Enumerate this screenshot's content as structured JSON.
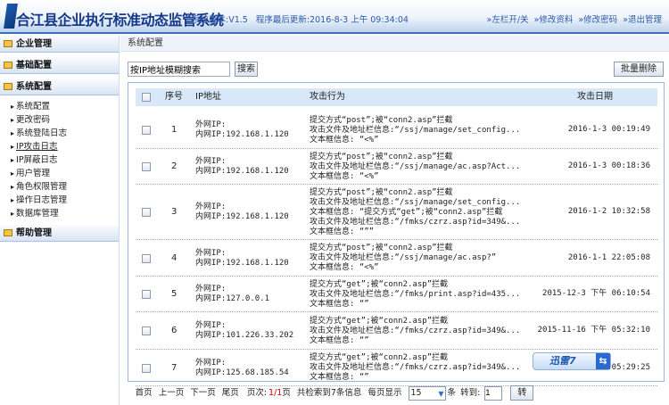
{
  "header": {
    "title": "合江县企业执行标准动态监管系统",
    "version": "系统版本:V1.5",
    "updated": "程序最后更新:2016-8-3 上午  09:34:04",
    "links": [
      "»左栏开/关",
      "»修改资料",
      "»修改密码",
      "»退出管理"
    ]
  },
  "sidebar": {
    "sections": [
      "企业管理",
      "基础配置",
      "系统配置",
      "帮助管理"
    ],
    "items": [
      "系统配置",
      "更改密码",
      "系统登陆日志",
      "IP攻击日志",
      "IP屏蔽日志",
      "用户管理",
      "角色权限管理",
      "操作日志管理",
      "数据库管理"
    ]
  },
  "breadcrumb": "系统配置",
  "search": {
    "value": "按IP地址模糊搜索",
    "button": "搜索",
    "batch_delete": "批量删除"
  },
  "table": {
    "headers": [
      "序号",
      "IP地址",
      "攻击行为",
      "攻击日期"
    ],
    "rows": [
      {
        "no": "1",
        "ip1": "外网IP:",
        "ip2": "内网IP:192.168.1.120",
        "act": [
          "提交方式“post”;被“conn2.asp”拦截",
          "攻击文件及地址栏信息:“/ssj/manage/set_config...",
          "文本框信息: “<%”"
        ],
        "date": "2016-1-3 00:19:49"
      },
      {
        "no": "2",
        "ip1": "外网IP:",
        "ip2": "内网IP:192.168.1.120",
        "act": [
          "提交方式“post”;被“conn2.asp”拦截",
          "攻击文件及地址栏信息:“/ssj/manage/ac.asp?Act...",
          "文本框信息: “<%”"
        ],
        "date": "2016-1-3 00:18:36"
      },
      {
        "no": "3",
        "ip1": "外网IP:",
        "ip2": "内网IP:192.168.1.120",
        "act": [
          "提交方式“post”;被“conn2.asp”拦截",
          "攻击文件及地址栏信息:“/ssj/manage/set_config...",
          "文本框信息: “提交方式“get”;被“conn2.asp”拦截",
          "攻击文件及地址栏信息:“/fmks/czrz.asp?id=349&...",
          "文本框信息: “”” "
        ],
        "date": "2016-1-2 10:32:58"
      },
      {
        "no": "4",
        "ip1": "外网IP:",
        "ip2": "内网IP:192.168.1.120",
        "act": [
          "提交方式“post”;被“conn2.asp”拦截",
          "攻击文件及地址栏信息:“/ssj/manage/ac.asp?”",
          "文本框信息: “<%”"
        ],
        "date": "2016-1-1 22:05:08"
      },
      {
        "no": "5",
        "ip1": "外网IP:",
        "ip2": "内网IP:127.0.0.1",
        "act": [
          "提交方式“get”;被“conn2.asp”拦截",
          "攻击文件及地址栏信息:“/fmks/print.asp?id=435...",
          "文本框信息: “”"
        ],
        "date": "2015-12-3 下午 06:10:54"
      },
      {
        "no": "6",
        "ip1": "外网IP:",
        "ip2": "内网IP:101.226.33.202",
        "act": [
          "提交方式“get”;被“conn2.asp”拦截",
          "攻击文件及地址栏信息:“/fmks/czrz.asp?id=349&...",
          "文本框信息: “”"
        ],
        "date": "2015-11-16 下午 05:32:10"
      },
      {
        "no": "7",
        "ip1": "外网IP:",
        "ip2": "内网IP:125.68.185.54",
        "act": [
          "提交方式“get”;被“conn2.asp”拦截",
          "攻击文件及地址栏信息:“/fmks/czrz.asp?id=349&...",
          "文本框信息: “”"
        ],
        "date": "2 05:29:25"
      }
    ]
  },
  "pager": {
    "first": "首页",
    "prev": "上一页",
    "next": "下一页",
    "last": "尾页",
    "page_label": "页次:",
    "page": "1/1",
    "page_unit": "页",
    "total": "共检索到7条信息",
    "per_page_label": "每页显示",
    "per_page": "15",
    "unit": "条",
    "goto_label": "转到:",
    "goto_value": "1",
    "goto_button": "转"
  },
  "overlay": {
    "label": "迅雷7"
  }
}
